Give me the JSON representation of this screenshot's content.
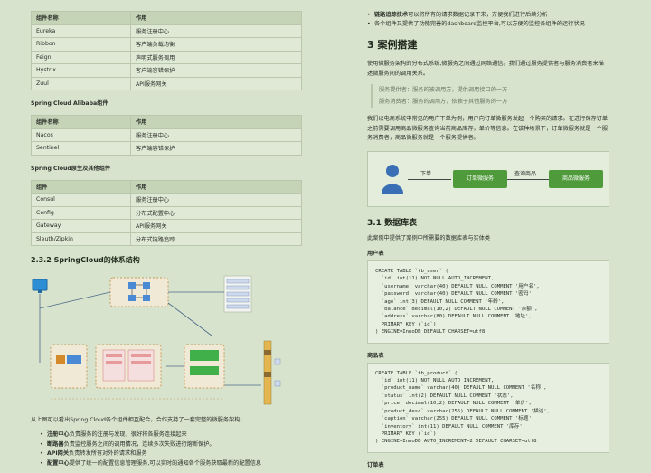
{
  "table_netflix": {
    "headers": [
      "组件名称",
      "作用"
    ],
    "rows": [
      [
        "Eureka",
        "服务注册中心"
      ],
      [
        "Ribbon",
        "客户端负载均衡"
      ],
      [
        "Feign",
        "声明式服务调用"
      ],
      [
        "Hystrix",
        "客户端容错保护"
      ],
      [
        "Zuul",
        "API服务网关"
      ]
    ]
  },
  "section_alibaba": "Spring Cloud Alibaba组件",
  "table_alibaba": {
    "headers": [
      "组件名称",
      "作用"
    ],
    "rows": [
      [
        "Nacos",
        "服务注册中心"
      ],
      [
        "Sentinel",
        "客户端容错保护"
      ]
    ]
  },
  "section_native": "Spring Cloud原生及其他组件",
  "table_native": {
    "headers": [
      "组件",
      "作用"
    ],
    "rows": [
      [
        "Consul",
        "服务注册中心"
      ],
      [
        "Config",
        "分布式配置中心"
      ],
      [
        "Gateway",
        "API服务网关"
      ],
      [
        "Sleuth/Zipkin",
        "分布式链路追踪"
      ]
    ]
  },
  "arch_heading": "2.3.2 SpringCloud的体系结构",
  "arch_desc": "从上图可以看出Spring Cloud各个组件相互配合，合作支持了一套完整的微服务架构。",
  "arch_bullets": [
    {
      "strong": "注册中心",
      "text": "负责服务的注册与发现，很好将各服务连接起来"
    },
    {
      "strong": "断路器",
      "text": "负责监控服务之间的调用情况，连续多次失败进行熔断保护。"
    },
    {
      "strong": "API网关",
      "text": "负责转发所有对外的请求和服务"
    },
    {
      "strong": "配置中心",
      "text": "提供了统一的配置信息管理服务,可以实时的通知各个服务获取最新的配置信息"
    }
  ],
  "right_top_bullets": [
    {
      "strong": "链路追踪技术",
      "text": "可以将所有的请求数据记录下来，方便我们进行后续分析"
    },
    {
      "strong": "",
      "text": "各个组件又提供了功能完善的dashboard监控平台,可以方便的监控各组件的运行状况"
    }
  ],
  "case_heading": "3 案例搭建",
  "case_intro": "使用微服务架构的分布式系统,微服务之间通过网络通信。我们通过服务提供者与服务消费者来描述微服务间的调用关系。",
  "quotes": [
    "服务提供者：服务的被调用方，提供调用接口的一方",
    "服务消费者：服务的调用方，依赖于其他服务的一方"
  ],
  "case_example": "我们以电商系统中常见的用户下单为例，用户向订单微服务发起一个购买的请求。在进行保存订单之前需要调用商品微服务查询当前商品库存，单价等信息。在该种场景下，订单微服务就是一个服务消费者，商品微服务就是一个服务提供者。",
  "flow": {
    "order_label": "下单",
    "order_service": "订单微服务",
    "query_label": "查询商品",
    "product_service": "商品微服务"
  },
  "db_heading": "3.1 数据库表",
  "db_intro": "此案例中提供了案例中所需要的数据库表与实体类",
  "user_table_label": "用户表",
  "user_sql": [
    "CREATE TABLE `tb_user` (",
    "  `id` int(11) NOT NULL AUTO_INCREMENT,",
    "  `username` varchar(40) DEFAULT NULL COMMENT '用户名',",
    "  `password` varchar(40) DEFAULT NULL COMMENT '密码',",
    "  `age` int(3) DEFAULT NULL COMMENT '年龄',",
    "  `balance` decimal(10,2) DEFAULT NULL COMMENT '余额',",
    "  `address` varchar(80) DEFAULT NULL COMMENT '地址',",
    "  PRIMARY KEY (`id`)",
    ") ENGINE=InnoDB DEFAULT CHARSET=utf8"
  ],
  "product_table_label": "商品表",
  "product_sql": [
    "CREATE TABLE `tb_product` (",
    "  `id` int(11) NOT NULL AUTO_INCREMENT,",
    "  `product_name` varchar(40) DEFAULT NULL COMMENT '名称',",
    "  `status` int(2) DEFAULT NULL COMMENT '状态',",
    "  `price` decimal(10,2) DEFAULT NULL COMMENT '单价',",
    "  `product_desc` varchar(255) DEFAULT NULL COMMENT '描述',",
    "  `caption` varchar(255) DEFAULT NULL COMMENT '标题',",
    "  `inventory` int(11) DEFAULT NULL COMMENT '库存',",
    "  PRIMARY KEY (`id`)",
    ") ENGINE=InnoDB AUTO_INCREMENT=2 DEFAULT CHARSET=utf8"
  ],
  "order_table_label": "订单表",
  "colors": {
    "background": "#d7e3cc",
    "flow_green": "#4f9a3a",
    "user_blue": "#3a6fb5"
  }
}
